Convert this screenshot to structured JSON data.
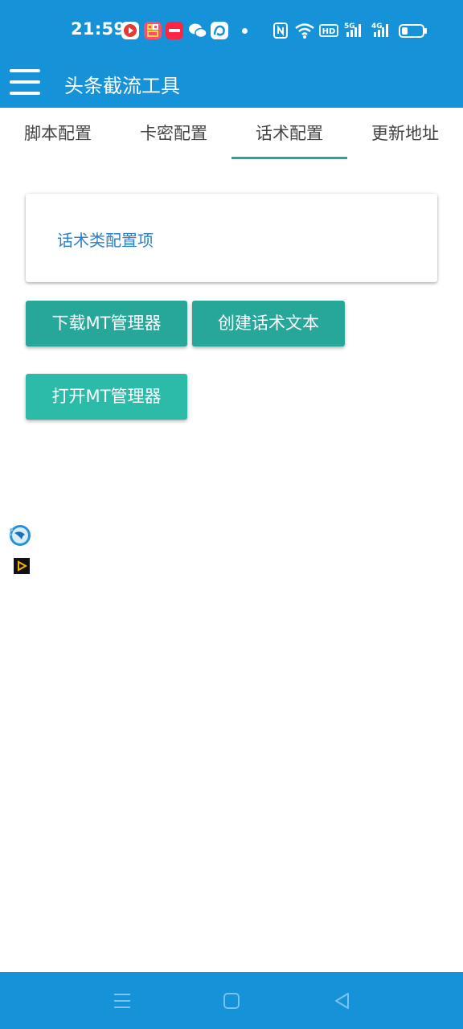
{
  "status_bar": {
    "time": "21:59",
    "notification_icons": [
      "video-app-icon",
      "shop-app-icon",
      "xiaohongshu-icon",
      "wechat-icon",
      "browser-app-icon"
    ],
    "hd_label": "HD",
    "signal_5g_label": "5G",
    "signal_4g_label": "4G",
    "icons": [
      "nfc-icon",
      "wifi-icon",
      "battery-icon"
    ]
  },
  "app_bar": {
    "title": "头条截流工具",
    "menu_icon": "hamburger-menu-icon"
  },
  "tabs": [
    {
      "label": "脚本配置",
      "active": false
    },
    {
      "label": "卡密配置",
      "active": false
    },
    {
      "label": "话术配置",
      "active": true
    },
    {
      "label": "更新地址",
      "active": false
    }
  ],
  "card": {
    "text": "话术类配置项"
  },
  "buttons": {
    "download_mt": "下载MT管理器",
    "create_script": "创建话术文本",
    "open_mt": "打开MT管理器"
  },
  "floating_icons": [
    "bird-app-icon",
    "play-app-icon"
  ],
  "nav_bar": {
    "icons": [
      "recents-menu-icon",
      "home-square-icon",
      "back-triangle-icon"
    ]
  },
  "colors": {
    "primary": "#1592d8",
    "accent": "#27a79a",
    "accent_light": "#2dbba9",
    "link_text": "#2d80c7"
  }
}
